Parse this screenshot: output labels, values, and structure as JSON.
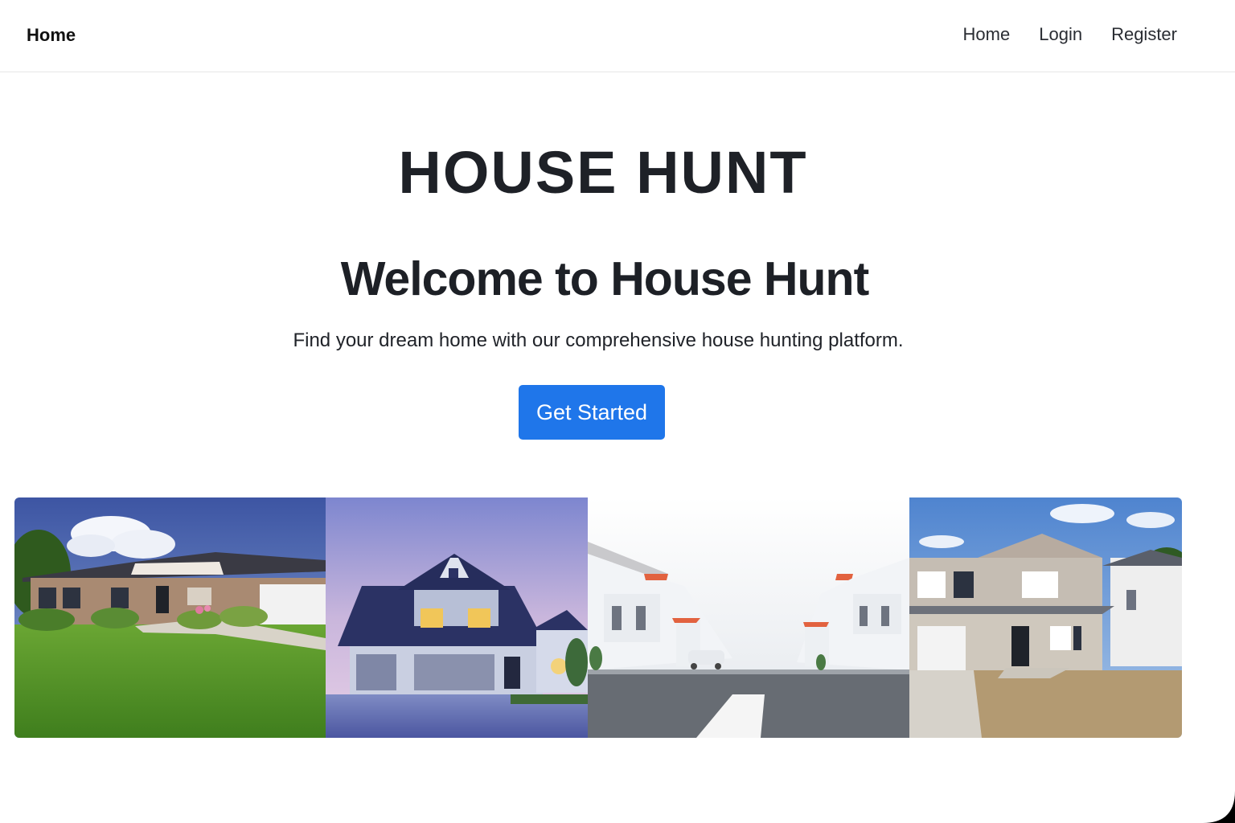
{
  "navbar": {
    "brand": "Home",
    "links": [
      "Home",
      "Login",
      "Register"
    ]
  },
  "hero": {
    "site_title": "HOUSE HUNT",
    "heading": "Welcome to House Hunt",
    "tagline": "Find your dream home with our comprehensive house hunting platform.",
    "cta_label": "Get Started"
  },
  "gallery": {
    "images": [
      "single-story-brick-house-photo",
      "blue-two-story-house-at-dusk-photo",
      "white-houses-street-photo",
      "beige-two-story-house-photo"
    ]
  },
  "colors": {
    "accent": "#1f76ea",
    "text": "#1c1f24",
    "background": "#ffffff"
  }
}
